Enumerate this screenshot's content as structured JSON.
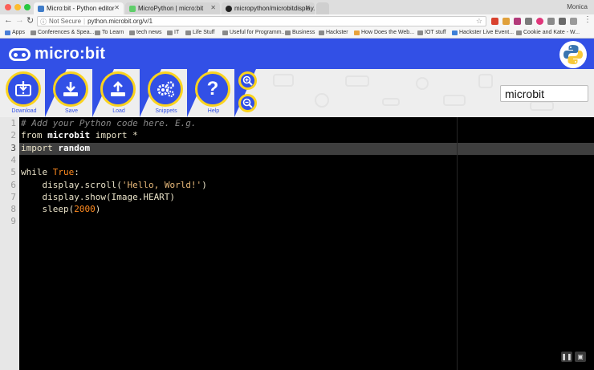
{
  "browser": {
    "tabs": [
      {
        "label": "Micro:bit - Python editor",
        "active": true
      },
      {
        "label": "MicroPython | micro:bit",
        "active": false
      },
      {
        "label": "micropython/microbitdisplay...",
        "active": false
      }
    ],
    "user": "Monica",
    "address": {
      "security": "Not Secure",
      "url": "python.microbit.org/v/1"
    },
    "bookmarks": [
      {
        "label": "Apps",
        "color": "#4a7fd7"
      },
      {
        "label": "Conferences & Spea...",
        "color": "#8a8a8a"
      },
      {
        "label": "To Learn",
        "color": "#8a8a8a"
      },
      {
        "label": "tech news",
        "color": "#8a8a8a"
      },
      {
        "label": "IT",
        "color": "#8a8a8a"
      },
      {
        "label": "Life Stuff",
        "color": "#8a8a8a"
      },
      {
        "label": "Useful for Programm...",
        "color": "#8a8a8a"
      },
      {
        "label": "Business",
        "color": "#8a8a8a"
      },
      {
        "label": "Hackster",
        "color": "#8a8a8a"
      },
      {
        "label": "How Does the Web...",
        "color": "#e8a33d"
      },
      {
        "label": "IOT stuff",
        "color": "#8a8a8a"
      },
      {
        "label": "Hackster Live Event...",
        "color": "#3d7fd8"
      },
      {
        "label": "Cookie and Kate - W...",
        "color": "#8a8a8a"
      }
    ]
  },
  "app": {
    "brand": "micro:bit",
    "tools": [
      {
        "label": "Download",
        "icon": "download-icon"
      },
      {
        "label": "Save",
        "icon": "save-icon"
      },
      {
        "label": "Load",
        "icon": "load-icon"
      },
      {
        "label": "Snippets",
        "icon": "gears-icon"
      },
      {
        "label": "Help",
        "icon": "help-icon"
      }
    ],
    "zoom_in_icon": "zoom-in-icon",
    "zoom_out_icon": "zoom-out-icon",
    "script_name": "microbit",
    "colors": {
      "brand_blue": "#3250e6",
      "accent_yellow": "#fbd31e"
    }
  },
  "editor": {
    "active_line": 3,
    "line_numbers": [
      "1",
      "2",
      "3",
      "4",
      "5",
      "6",
      "7",
      "8",
      "9"
    ],
    "lines": [
      [
        {
          "t": "# Add your Python code here. E.g.",
          "c": "cm"
        }
      ],
      [
        {
          "t": "from ",
          "c": "kw"
        },
        {
          "t": "microbit",
          "c": "bd"
        },
        {
          "t": " import ",
          "c": "kw"
        },
        {
          "t": "*",
          "c": "kw"
        }
      ],
      [
        {
          "t": "import ",
          "c": "kw"
        },
        {
          "t": "random",
          "c": "bd"
        }
      ],
      [],
      [
        {
          "t": "while ",
          "c": "kw"
        },
        {
          "t": "True",
          "c": "cn"
        },
        {
          "t": ":",
          "c": "kw"
        }
      ],
      [
        {
          "t": "    display.scroll(",
          "c": "kw"
        },
        {
          "t": "'Hello, World!'",
          "c": "st"
        },
        {
          "t": ")",
          "c": "kw"
        }
      ],
      [
        {
          "t": "    display.show(Image.HEART)",
          "c": "kw"
        }
      ],
      [
        {
          "t": "    sleep(",
          "c": "kw"
        },
        {
          "t": "2000",
          "c": "nm"
        },
        {
          "t": ")",
          "c": "kw"
        }
      ],
      []
    ]
  }
}
